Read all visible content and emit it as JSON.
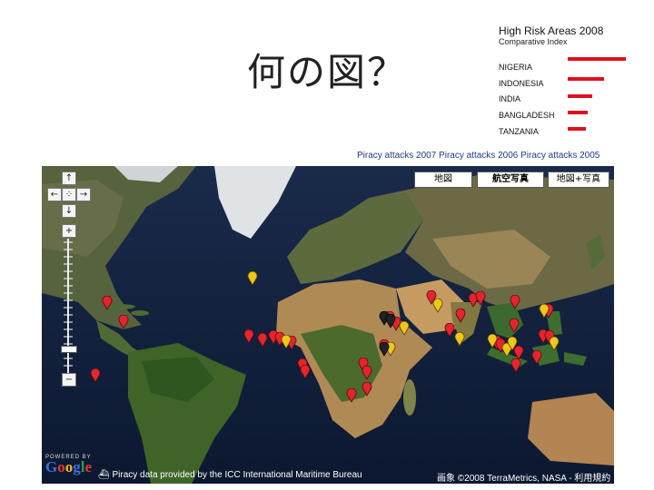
{
  "slide": {
    "title": "何の図？"
  },
  "legend": {
    "title": "High Risk Areas 2008",
    "subtitle": "Comparative Index",
    "bar_color": "#e0101e",
    "countries": [
      {
        "name": "NIGERIA",
        "index": 1.0
      },
      {
        "name": "INDONESIA",
        "index": 0.62
      },
      {
        "name": "INDIA",
        "index": 0.42
      },
      {
        "name": "BANGLADESH",
        "index": 0.35
      },
      {
        "name": "TANZANIA",
        "index": 0.32
      }
    ]
  },
  "attack_links": [
    "Piracy attacks 2007",
    "Piracy attacks 2006",
    "Piracy attacks 2005"
  ],
  "map": {
    "type_buttons": [
      {
        "label": "地図",
        "active": false
      },
      {
        "label": "航空写真",
        "active": true
      },
      {
        "label": "地図+写真",
        "active": false
      }
    ],
    "nav": {
      "up": "↑",
      "left": "←",
      "center": "⁘",
      "right": "→",
      "down": "↓",
      "zoom_in": "+",
      "zoom_out": "−"
    },
    "powered_by": "POWERED BY",
    "google_logo": "Google",
    "data_credit": "Piracy data provided by the ICC International Maritime Bureau",
    "copyright": "画象 ©2008 TerraMetrics, NASA - 利用規約",
    "marker_colors": {
      "red": "#e4252e",
      "yellow": "#f1c61a"
    }
  }
}
